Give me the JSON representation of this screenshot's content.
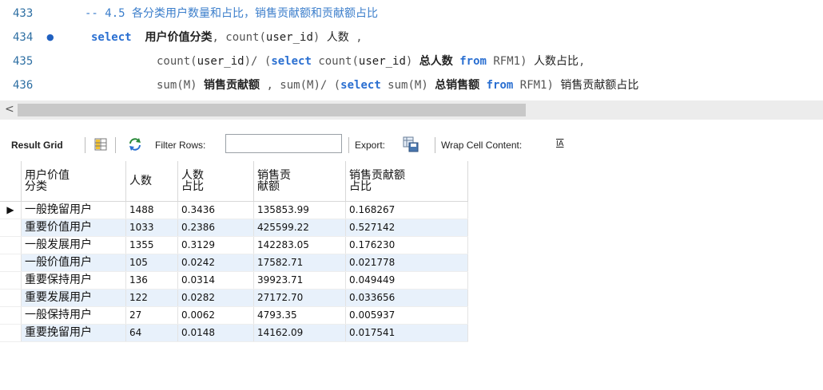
{
  "editor": {
    "lines": [
      {
        "number": "433",
        "comment": "-- 4.5 各分类用户数量和占比，销售贡献额和贡献额占比"
      },
      {
        "number": "434",
        "tokens": [
          "select",
          "用户价值分类",
          ", count(",
          "user_id",
          ") ",
          "人数",
          " ,"
        ]
      },
      {
        "number": "435",
        "tokens": [
          "count(",
          "user_id",
          ")/ (",
          "select",
          " count(",
          "user_id",
          ") ",
          "总人数",
          " ",
          "from",
          " RFM1) ",
          "人数占比",
          ","
        ]
      },
      {
        "number": "436",
        "tokens": [
          "sum(M) ",
          "销售贡献额",
          " , sum(M)/ (",
          "select",
          " sum(M) ",
          "总销售额",
          " ",
          "from",
          " RFM1) ",
          "销售贡献额占比"
        ]
      }
    ]
  },
  "scrollbar": {
    "left_arrow": "<"
  },
  "toolbar": {
    "result_grid": "Result Grid",
    "filter_rows": "Filter Rows:",
    "export": "Export:",
    "wrap_cell": "Wrap Cell Content:",
    "wrap_icon_glyph": "IA"
  },
  "grid": {
    "headers": [
      "用户价值\n分类",
      "人数",
      "人数\n占比",
      "销售贡\n献额",
      "销售贡献额\n占比"
    ],
    "row_marker": "▶",
    "rows": [
      [
        "一般挽留用户",
        "1488",
        "0.3436",
        "135853.99",
        "0.168267"
      ],
      [
        "重要价值用户",
        "1033",
        "0.2386",
        "425599.22",
        "0.527142"
      ],
      [
        "一般发展用户",
        "1355",
        "0.3129",
        "142283.05",
        "0.176230"
      ],
      [
        "一般价值用户",
        "105",
        "0.0242",
        "17582.71",
        "0.021778"
      ],
      [
        "重要保持用户",
        "136",
        "0.0314",
        "39923.71",
        "0.049449"
      ],
      [
        "重要发展用户",
        "122",
        "0.0282",
        "27172.70",
        "0.033656"
      ],
      [
        "一般保持用户",
        "27",
        "0.0062",
        "4793.35",
        "0.005937"
      ],
      [
        "重要挽留用户",
        "64",
        "0.0148",
        "14162.09",
        "0.017541"
      ]
    ]
  },
  "colors": {
    "keyword": "#2a6fd1",
    "line_number": "#2e6fa3",
    "alt_row": "#e8f1fb"
  }
}
